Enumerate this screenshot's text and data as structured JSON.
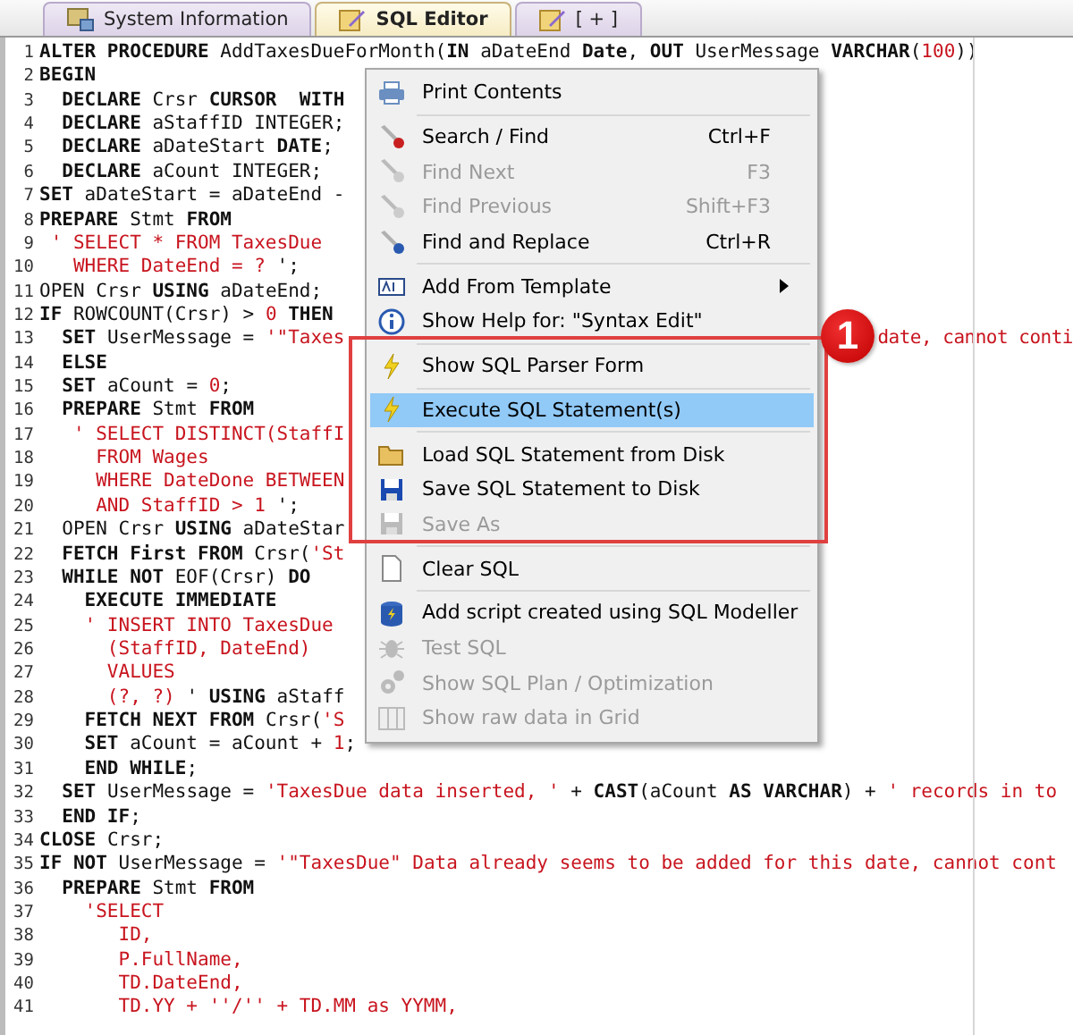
{
  "tabs": [
    {
      "label": "System Information",
      "selected": false
    },
    {
      "label": "SQL Editor",
      "selected": true
    },
    {
      "label": "[ + ]",
      "selected": false
    }
  ],
  "editor": {
    "lines": [
      {
        "n": "1",
        "parts": [
          {
            "kind": "kw",
            "text": "ALTER PROCEDURE "
          },
          {
            "kind": "plain",
            "text": "AddTaxesDueForMonth("
          },
          {
            "kind": "kw",
            "text": "IN "
          },
          {
            "kind": "plain",
            "text": "aDateEnd "
          },
          {
            "kind": "kw",
            "text": "Date"
          },
          {
            "kind": "plain",
            "text": ", "
          },
          {
            "kind": "kw",
            "text": "OUT "
          },
          {
            "kind": "plain",
            "text": "UserMessage "
          },
          {
            "kind": "kw",
            "text": "VARCHAR"
          },
          {
            "kind": "plain",
            "text": "("
          },
          {
            "kind": "str",
            "text": "100"
          },
          {
            "kind": "plain",
            "text": "))"
          }
        ]
      },
      {
        "n": "2",
        "parts": [
          {
            "kind": "kw",
            "text": "BEGIN"
          }
        ]
      },
      {
        "n": "3",
        "parts": [
          {
            "kind": "kw",
            "text": "  DECLARE "
          },
          {
            "kind": "plain",
            "text": "Crsr "
          },
          {
            "kind": "kw",
            "text": "CURSOR  WITH"
          }
        ]
      },
      {
        "n": "4",
        "parts": [
          {
            "kind": "kw",
            "text": "  DECLARE "
          },
          {
            "kind": "plain",
            "text": "aStaffID INTEGER;"
          }
        ]
      },
      {
        "n": "5",
        "parts": [
          {
            "kind": "kw",
            "text": "  DECLARE "
          },
          {
            "kind": "plain",
            "text": "aDateStart "
          },
          {
            "kind": "kw",
            "text": "DATE"
          },
          {
            "kind": "plain",
            "text": ";"
          }
        ]
      },
      {
        "n": "6",
        "parts": [
          {
            "kind": "kw",
            "text": "  DECLARE "
          },
          {
            "kind": "plain",
            "text": "aCount INTEGER;"
          }
        ]
      },
      {
        "n": "7",
        "parts": [
          {
            "kind": "kw",
            "text": "SET "
          },
          {
            "kind": "plain",
            "text": "aDateStart = aDateEnd -"
          }
        ]
      },
      {
        "n": "8",
        "parts": [
          {
            "kind": "kw",
            "text": "PREPARE "
          },
          {
            "kind": "plain",
            "text": "Stmt "
          },
          {
            "kind": "kw",
            "text": "FROM"
          }
        ]
      },
      {
        "n": "9",
        "parts": [
          {
            "kind": "str",
            "text": " ' SELECT * FROM TaxesDue"
          }
        ]
      },
      {
        "n": "10",
        "parts": [
          {
            "kind": "str",
            "text": "   WHERE DateEnd = ? "
          },
          {
            "kind": "plain",
            "text": "';"
          }
        ]
      },
      {
        "n": "11",
        "parts": [
          {
            "kind": "plain",
            "text": "OPEN Crsr "
          },
          {
            "kind": "kw",
            "text": "USING "
          },
          {
            "kind": "plain",
            "text": "aDateEnd;"
          }
        ]
      },
      {
        "n": "12",
        "parts": [
          {
            "kind": "kw",
            "text": "IF "
          },
          {
            "kind": "plain",
            "text": "ROWCOUNT(Crsr) > "
          },
          {
            "kind": "str",
            "text": "0"
          },
          {
            "kind": "kw",
            "text": " THEN"
          }
        ]
      },
      {
        "n": "13",
        "parts": [
          {
            "kind": "kw",
            "text": "  SET "
          },
          {
            "kind": "plain",
            "text": "UserMessage = "
          },
          {
            "kind": "str",
            "text": "'\"Taxes"
          },
          {
            "kind": "tail",
            "text": "date, cannot conti"
          }
        ]
      },
      {
        "n": "14",
        "parts": [
          {
            "kind": "kw",
            "text": "  ELSE"
          }
        ]
      },
      {
        "n": "15",
        "parts": [
          {
            "kind": "kw",
            "text": "  SET "
          },
          {
            "kind": "plain",
            "text": "aCount = "
          },
          {
            "kind": "str",
            "text": "0"
          },
          {
            "kind": "plain",
            "text": ";"
          }
        ]
      },
      {
        "n": "16",
        "parts": [
          {
            "kind": "kw",
            "text": "  PREPARE "
          },
          {
            "kind": "plain",
            "text": "Stmt "
          },
          {
            "kind": "kw",
            "text": "FROM"
          }
        ]
      },
      {
        "n": "17",
        "parts": [
          {
            "kind": "str",
            "text": "   ' SELECT DISTINCT(StaffI"
          }
        ]
      },
      {
        "n": "18",
        "parts": [
          {
            "kind": "str",
            "text": "     FROM Wages"
          }
        ]
      },
      {
        "n": "19",
        "parts": [
          {
            "kind": "str",
            "text": "     WHERE DateDone BETWEEN"
          }
        ]
      },
      {
        "n": "20",
        "parts": [
          {
            "kind": "str",
            "text": "     AND StaffID > 1 "
          },
          {
            "kind": "plain",
            "text": "';"
          }
        ]
      },
      {
        "n": "21",
        "parts": [
          {
            "kind": "plain",
            "text": "  OPEN Crsr "
          },
          {
            "kind": "kw",
            "text": "USING "
          },
          {
            "kind": "plain",
            "text": "aDateStar"
          }
        ]
      },
      {
        "n": "22",
        "parts": [
          {
            "kind": "kw",
            "text": "  FETCH First FROM "
          },
          {
            "kind": "plain",
            "text": "Crsr("
          },
          {
            "kind": "str",
            "text": "'St"
          }
        ]
      },
      {
        "n": "23",
        "parts": [
          {
            "kind": "kw",
            "text": "  WHILE NOT "
          },
          {
            "kind": "plain",
            "text": "EOF(Crsr) "
          },
          {
            "kind": "kw",
            "text": "DO"
          }
        ]
      },
      {
        "n": "24",
        "parts": [
          {
            "kind": "kw",
            "text": "    EXECUTE IMMEDIATE"
          }
        ]
      },
      {
        "n": "25",
        "parts": [
          {
            "kind": "str",
            "text": "    ' INSERT INTO TaxesDue"
          }
        ]
      },
      {
        "n": "26",
        "parts": [
          {
            "kind": "str",
            "text": "      (StaffID, DateEnd)"
          }
        ]
      },
      {
        "n": "27",
        "parts": [
          {
            "kind": "str",
            "text": "      VALUES"
          }
        ]
      },
      {
        "n": "28",
        "parts": [
          {
            "kind": "str",
            "text": "      (?, ?) "
          },
          {
            "kind": "plain",
            "text": "' "
          },
          {
            "kind": "kw",
            "text": "USING "
          },
          {
            "kind": "plain",
            "text": "aStaff"
          }
        ]
      },
      {
        "n": "29",
        "parts": [
          {
            "kind": "kw",
            "text": "    FETCH NEXT FROM "
          },
          {
            "kind": "plain",
            "text": "Crsr("
          },
          {
            "kind": "str",
            "text": "'S"
          }
        ]
      },
      {
        "n": "30",
        "parts": [
          {
            "kind": "kw",
            "text": "    SET "
          },
          {
            "kind": "plain",
            "text": "aCount = aCount + "
          },
          {
            "kind": "str",
            "text": "1"
          },
          {
            "kind": "plain",
            "text": ";"
          }
        ]
      },
      {
        "n": "31",
        "parts": [
          {
            "kind": "kw",
            "text": "    END WHILE"
          },
          {
            "kind": "plain",
            "text": ";"
          }
        ]
      },
      {
        "n": "32",
        "parts": [
          {
            "kind": "kw",
            "text": "  SET "
          },
          {
            "kind": "plain",
            "text": "UserMessage = "
          },
          {
            "kind": "str",
            "text": "'TaxesDue data inserted, ' "
          },
          {
            "kind": "plain",
            "text": "+ "
          },
          {
            "kind": "kw",
            "text": "CAST"
          },
          {
            "kind": "plain",
            "text": "(aCount "
          },
          {
            "kind": "kw",
            "text": "AS VARCHAR"
          },
          {
            "kind": "plain",
            "text": ") + "
          },
          {
            "kind": "str",
            "text": "' records in to"
          }
        ]
      },
      {
        "n": "33",
        "parts": [
          {
            "kind": "kw",
            "text": "  END IF"
          },
          {
            "kind": "plain",
            "text": ";"
          }
        ]
      },
      {
        "n": "34",
        "parts": [
          {
            "kind": "kw",
            "text": "CLOSE "
          },
          {
            "kind": "plain",
            "text": "Crsr;"
          }
        ]
      },
      {
        "n": "35",
        "parts": [
          {
            "kind": "kw",
            "text": "IF NOT "
          },
          {
            "kind": "plain",
            "text": "UserMessage = "
          },
          {
            "kind": "str",
            "text": "'\"TaxesDue\" Data already seems to be added for this date, cannot cont"
          }
        ]
      },
      {
        "n": "36",
        "parts": [
          {
            "kind": "kw",
            "text": "  PREPARE "
          },
          {
            "kind": "plain",
            "text": "Stmt "
          },
          {
            "kind": "kw",
            "text": "FROM"
          }
        ]
      },
      {
        "n": "37",
        "parts": [
          {
            "kind": "str",
            "text": "    'SELECT"
          }
        ]
      },
      {
        "n": "38",
        "parts": [
          {
            "kind": "str",
            "text": "       ID,"
          }
        ]
      },
      {
        "n": "39",
        "parts": [
          {
            "kind": "str",
            "text": "       P.FullName,"
          }
        ]
      },
      {
        "n": "40",
        "parts": [
          {
            "kind": "str",
            "text": "       TD.DateEnd,"
          }
        ]
      },
      {
        "n": "41",
        "parts": [
          {
            "kind": "str",
            "text": "       TD.YY + ''/'' + TD.MM as YYMM,"
          }
        ]
      }
    ]
  },
  "context_menu": {
    "groups": [
      {
        "items": [
          {
            "label": "Print Contents",
            "disabled": false,
            "selected": false
          }
        ]
      },
      {
        "items": [
          {
            "label": "Search / Find",
            "shortcut": "Ctrl+F",
            "disabled": false,
            "selected": false
          },
          {
            "label": "Find Next",
            "shortcut": "F3",
            "disabled": true,
            "selected": false
          },
          {
            "label": "Find Previous",
            "shortcut": "Shift+F3",
            "disabled": true,
            "selected": false
          },
          {
            "label": "Find and Replace",
            "shortcut": "Ctrl+R",
            "disabled": false,
            "selected": false
          }
        ]
      },
      {
        "items": [
          {
            "label": "Add From Template",
            "submenu": true,
            "disabled": false,
            "selected": false
          },
          {
            "label": "Show Help for: \"Syntax Edit\"",
            "disabled": false,
            "selected": false
          }
        ]
      },
      {
        "items": [
          {
            "label": "Show SQL Parser Form",
            "disabled": false,
            "selected": false
          }
        ]
      },
      {
        "items": [
          {
            "label": "Execute SQL Statement(s)",
            "disabled": false,
            "selected": true
          }
        ]
      },
      {
        "items": [
          {
            "label": "Load SQL Statement from Disk",
            "disabled": false,
            "selected": false
          },
          {
            "label": "Save SQL Statement to Disk",
            "disabled": false,
            "selected": false
          },
          {
            "label": "Save As",
            "disabled": true,
            "selected": false
          }
        ]
      },
      {
        "items": [
          {
            "label": "Clear SQL",
            "disabled": false,
            "selected": false
          }
        ]
      },
      {
        "items": [
          {
            "label": "Add script created using SQL Modeller",
            "disabled": false,
            "selected": false
          },
          {
            "label": "Test SQL",
            "disabled": true,
            "selected": false
          },
          {
            "label": "Show SQL Plan / Optimization",
            "disabled": true,
            "selected": false
          },
          {
            "label": "Show raw data in Grid",
            "disabled": true,
            "selected": false
          }
        ]
      }
    ]
  },
  "callout": {
    "label": "1"
  }
}
